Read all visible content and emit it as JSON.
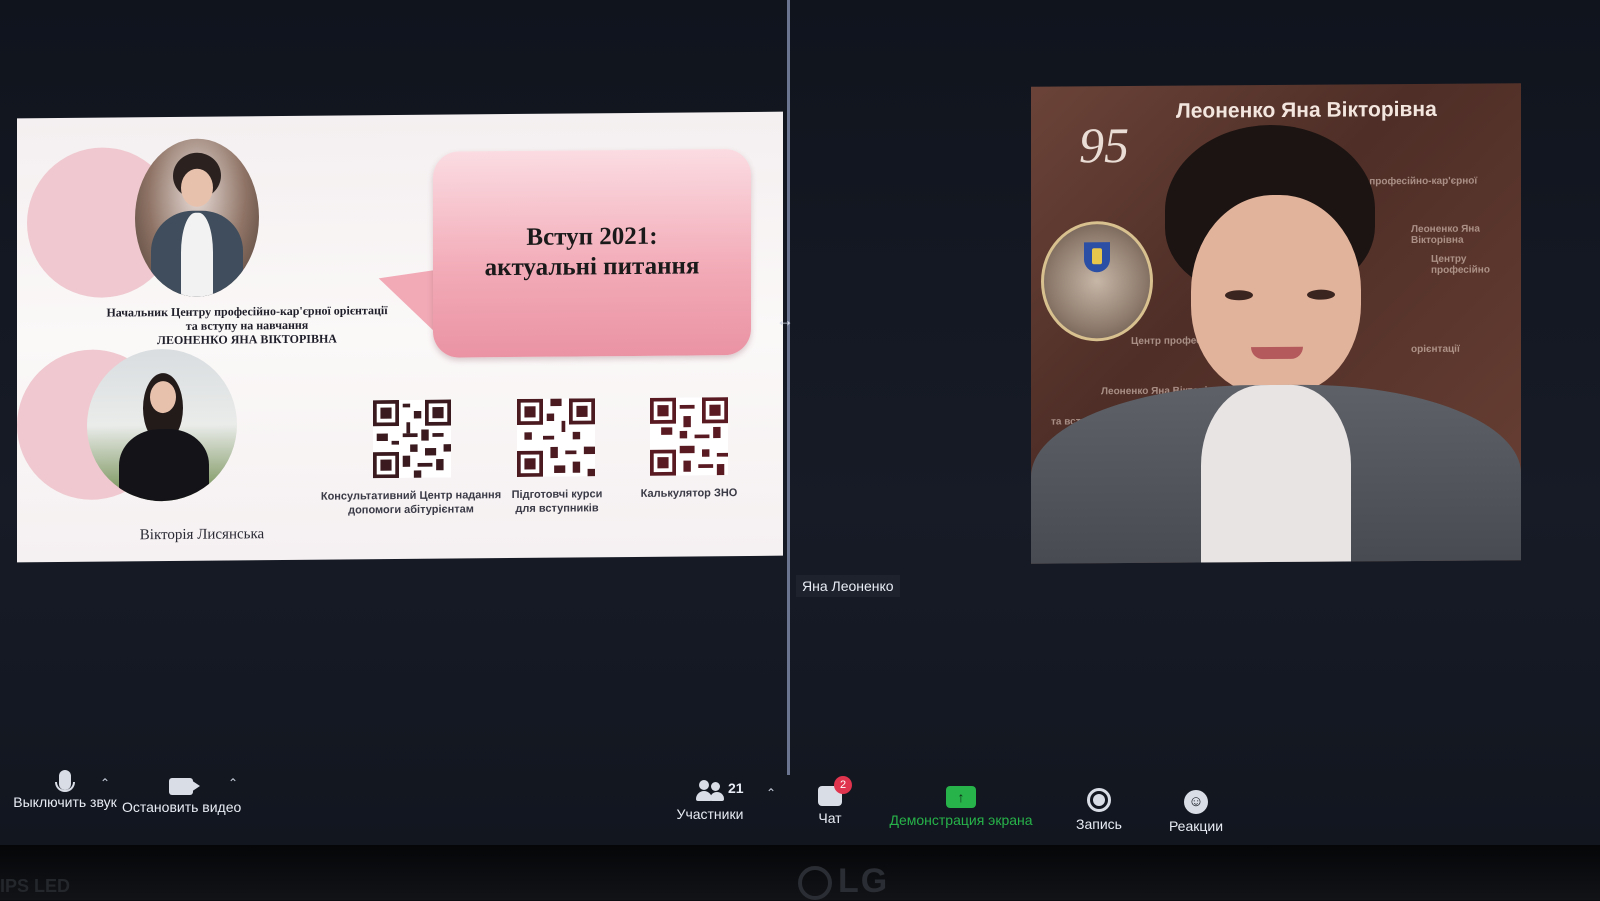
{
  "slide": {
    "title_line1": "Вступ 2021:",
    "title_line2": "актуальні питання",
    "caption_line1": "Начальник Центру професійно-кар'єрної орієнтації",
    "caption_line2": "та вступу на навчання",
    "caption_line3": "ЛЕОНЕНКО ЯНА ВІКТОРІВНА",
    "second_person": "Вікторія Лисянська",
    "qr_codes": [
      {
        "label_line1": "Консультативний Центр надання",
        "label_line2": "допомоги абітурієнтам"
      },
      {
        "label_line1": "Підготовчі курси",
        "label_line2": "для вступників"
      },
      {
        "label_line1": "Калькулятор ЗНО",
        "label_line2": ""
      }
    ]
  },
  "video": {
    "banner_name": "Леоненко Яна Вікторівна",
    "anniversary": "95",
    "participant_name": "Яна Леоненко"
  },
  "toolbar": {
    "mute_label": "Выключить звук",
    "video_label": "Остановить видео",
    "participants_label": "Участники",
    "participants_count": "21",
    "chat_label": "Чат",
    "chat_badge": "2",
    "share_label": "Демонстрация экрана",
    "record_label": "Запись",
    "reactions_label": "Реакции"
  },
  "monitor": {
    "brand": "LG",
    "panel_type": "IPS LED"
  },
  "colors": {
    "share_green": "#27b34a",
    "badge_red": "#e0334d",
    "bubble_pink": "#f2a9b6"
  },
  "icons": [
    "mic-icon",
    "camera-icon",
    "participants-icon",
    "chat-icon",
    "share-screen-icon",
    "record-icon",
    "reactions-icon",
    "caret-up-icon"
  ]
}
